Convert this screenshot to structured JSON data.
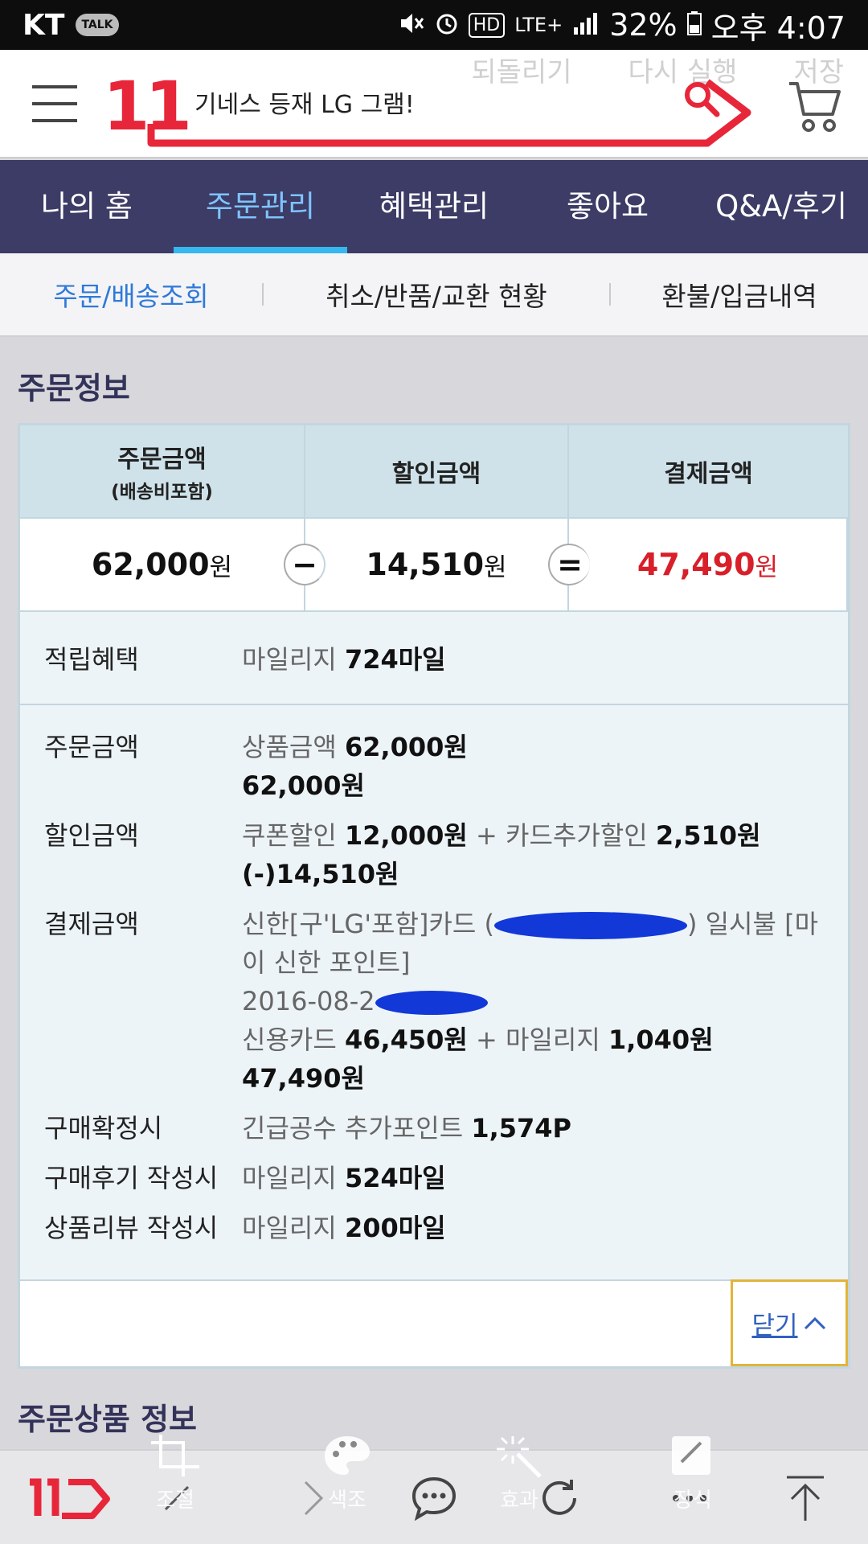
{
  "status_bar": {
    "carrier": "KT",
    "talk_badge": "TALK",
    "hd": "HD",
    "network": "LTE+",
    "battery": "32%",
    "time": "오후 4:07"
  },
  "editor_overlay": {
    "undo": "되돌리기",
    "redo": "다시 실행",
    "save": "저장"
  },
  "header": {
    "logo": "11",
    "search_text": "기네스 등재 LG 그램!"
  },
  "main_nav": {
    "tabs": [
      "나의 홈",
      "주문관리",
      "혜택관리",
      "좋아요",
      "Q&A/후기"
    ],
    "active_index": 1
  },
  "sub_nav": {
    "tabs": [
      "주문/배송조회",
      "취소/반품/교환 현황",
      "환불/입금내역"
    ],
    "active_index": 0
  },
  "order_info": {
    "title": "주문정보",
    "summary": {
      "order_amount_label": "주문금액",
      "order_amount_sub": "(배송비포함)",
      "discount_label": "할인금액",
      "payment_label": "결제금액",
      "order_amount": "62,000",
      "discount_amount": "14,510",
      "payment_amount": "47,490",
      "currency": "원",
      "minus": "−",
      "equals": "="
    },
    "mileage": {
      "label": "적립혜택",
      "prefix": "마일리지",
      "value": "724마일"
    },
    "details": {
      "order": {
        "label": "주문금액",
        "item_label": "상품금액",
        "item_value": "62,000원",
        "total": "62,000원"
      },
      "discount": {
        "label": "할인금액",
        "coupon_label": "쿠폰할인",
        "coupon_value": "12,000원",
        "plus": "+",
        "card_label": "카드추가할인",
        "card_value": "2,510원",
        "total": "(-)14,510원"
      },
      "payment": {
        "label": "결제금액",
        "card_prefix": "신한[구'LG'포함]카드 (",
        "card_suffix": ") 일시불 [마이 신한 포인트]",
        "date_prefix": "2016-08-2",
        "credit_label": "신용카드",
        "credit_value": "46,450원",
        "plus": "+",
        "mileage_label": "마일리지",
        "mileage_value": "1,040원",
        "total": "47,490원"
      },
      "confirm": {
        "label": "구매확정시",
        "prefix": "긴급공수 추가포인트",
        "value": "1,574P"
      },
      "review": {
        "label": "구매후기 작성시",
        "prefix": "마일리지",
        "value": "524마일"
      },
      "product_review": {
        "label": "상품리뷰 작성시",
        "prefix": "마일리지",
        "value": "200마일"
      }
    },
    "close_button": "닫기"
  },
  "order_products": {
    "title": "주문상품 정보"
  },
  "editor_tools": [
    "조절",
    "색조",
    "효과",
    "장식"
  ],
  "bottom_bar": {
    "logo": "11"
  },
  "colors": {
    "brand_red": "#e8263a",
    "nav_bg": "#3c3c66",
    "active_tab": "#7fc4ff",
    "payment_red": "#d81f2a"
  }
}
